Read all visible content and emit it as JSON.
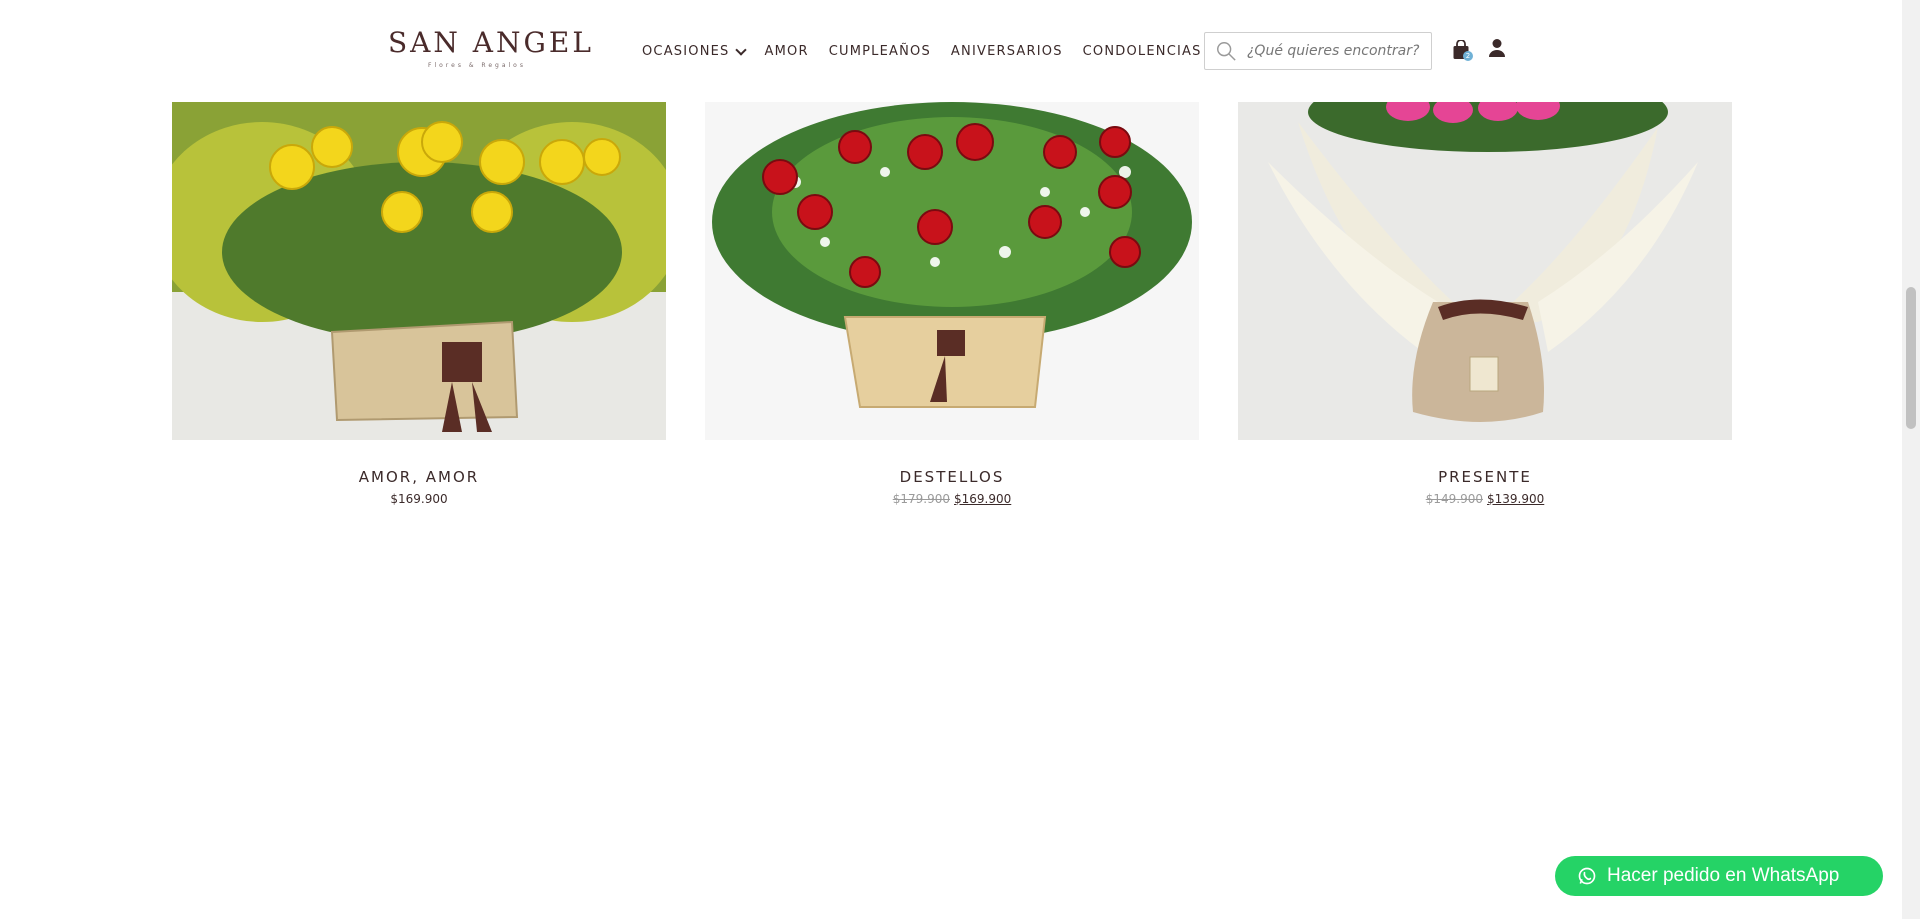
{
  "header": {
    "logo_text": "SAN ANGEL",
    "logo_sub": "Flores & Regalos",
    "nav": [
      {
        "label": "OCASIONES",
        "has_dropdown": true
      },
      {
        "label": "AMOR"
      },
      {
        "label": "CUMPLEAÑOS"
      },
      {
        "label": "ANIVERSARIOS"
      },
      {
        "label": "CONDOLENCIAS"
      }
    ],
    "search_placeholder": "¿Qué quieres encontrar?",
    "cart_count": "2"
  },
  "products": [
    {
      "name": "AMOR, AMOR",
      "price": "$169.900",
      "old_price": ""
    },
    {
      "name": "DESTELLOS",
      "price": "$169.900",
      "old_price": "$179.900"
    },
    {
      "name": "PRESENTE",
      "price": "$139.900",
      "old_price": "$149.900"
    }
  ],
  "whatsapp_label": "Hacer pedido en WhatsApp",
  "colors": {
    "brand": "#4a2b2b",
    "whatsapp": "#25d366"
  }
}
